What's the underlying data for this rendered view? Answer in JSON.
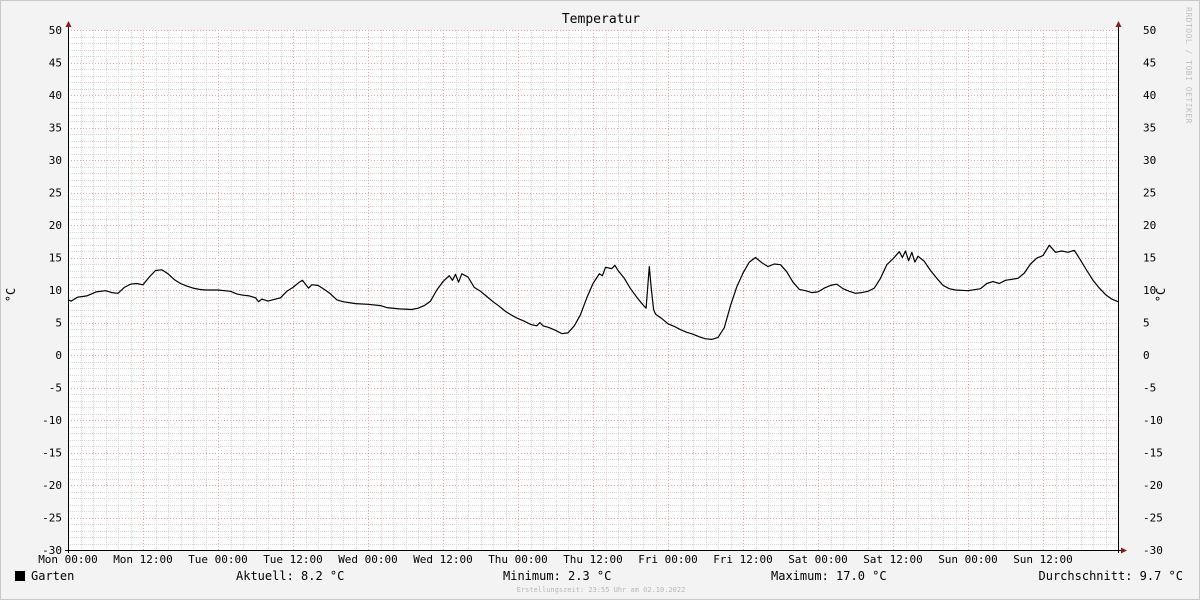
{
  "chart_data": {
    "type": "line",
    "title": "Temperatur",
    "ylabel_left": "°C",
    "ylabel_right": "°C",
    "ylim": [
      -30,
      50
    ],
    "yticks": [
      50,
      45,
      40,
      35,
      30,
      25,
      20,
      15,
      10,
      5,
      0,
      -5,
      -10,
      -15,
      -20,
      -25,
      -30
    ],
    "xlim": [
      0,
      168
    ],
    "xticks": [
      {
        "x": 0,
        "label": "Mon 00:00"
      },
      {
        "x": 12,
        "label": "Mon 12:00"
      },
      {
        "x": 24,
        "label": "Tue 00:00"
      },
      {
        "x": 36,
        "label": "Tue 12:00"
      },
      {
        "x": 48,
        "label": "Wed 00:00"
      },
      {
        "x": 60,
        "label": "Wed 12:00"
      },
      {
        "x": 72,
        "label": "Thu 00:00"
      },
      {
        "x": 84,
        "label": "Thu 12:00"
      },
      {
        "x": 96,
        "label": "Fri 00:00"
      },
      {
        "x": 108,
        "label": "Fri 12:00"
      },
      {
        "x": 120,
        "label": "Sat 00:00"
      },
      {
        "x": 132,
        "label": "Sat 12:00"
      },
      {
        "x": 144,
        "label": "Sun 00:00"
      },
      {
        "x": 156,
        "label": "Sun 12:00"
      }
    ],
    "grid": true,
    "series": [
      {
        "name": "Garten",
        "color": "#000000",
        "points": [
          [
            0,
            8.5
          ],
          [
            0.5,
            8.3
          ],
          [
            1.5,
            8.9
          ],
          [
            3,
            9.1
          ],
          [
            4.5,
            9.7
          ],
          [
            6,
            9.9
          ],
          [
            7,
            9.6
          ],
          [
            8,
            9.5
          ],
          [
            9,
            10.4
          ],
          [
            10,
            10.9
          ],
          [
            11,
            11.0
          ],
          [
            12,
            10.8
          ],
          [
            13,
            12.0
          ],
          [
            14,
            13.0
          ],
          [
            15,
            13.1
          ],
          [
            16,
            12.5
          ],
          [
            17,
            11.6
          ],
          [
            18,
            11.0
          ],
          [
            19,
            10.6
          ],
          [
            20,
            10.3
          ],
          [
            21,
            10.1
          ],
          [
            22,
            10.0
          ],
          [
            24,
            10.0
          ],
          [
            26,
            9.8
          ],
          [
            27,
            9.4
          ],
          [
            28,
            9.2
          ],
          [
            29,
            9.1
          ],
          [
            30,
            8.8
          ],
          [
            30.5,
            8.2
          ],
          [
            31,
            8.6
          ],
          [
            32,
            8.3
          ],
          [
            34,
            8.8
          ],
          [
            35,
            9.8
          ],
          [
            36,
            10.4
          ],
          [
            37,
            11.2
          ],
          [
            37.5,
            11.5
          ],
          [
            38,
            10.9
          ],
          [
            38.5,
            10.3
          ],
          [
            39,
            10.8
          ],
          [
            40,
            10.7
          ],
          [
            41,
            10.1
          ],
          [
            42,
            9.4
          ],
          [
            43,
            8.5
          ],
          [
            44,
            8.2
          ],
          [
            46,
            7.9
          ],
          [
            48,
            7.8
          ],
          [
            50,
            7.6
          ],
          [
            51,
            7.3
          ],
          [
            53,
            7.1
          ],
          [
            55,
            7.0
          ],
          [
            56,
            7.2
          ],
          [
            57,
            7.6
          ],
          [
            58,
            8.3
          ],
          [
            59,
            10.0
          ],
          [
            60,
            11.3
          ],
          [
            61,
            12.2
          ],
          [
            61.5,
            11.5
          ],
          [
            62,
            12.4
          ],
          [
            62.5,
            11.2
          ],
          [
            63,
            12.5
          ],
          [
            64,
            12.0
          ],
          [
            65,
            10.4
          ],
          [
            66,
            9.8
          ],
          [
            67,
            9.0
          ],
          [
            68,
            8.2
          ],
          [
            69,
            7.5
          ],
          [
            70,
            6.7
          ],
          [
            71,
            6.1
          ],
          [
            72,
            5.6
          ],
          [
            73,
            5.2
          ],
          [
            74,
            4.7
          ],
          [
            75,
            4.5
          ],
          [
            75.5,
            5.0
          ],
          [
            76,
            4.5
          ],
          [
            77,
            4.2
          ],
          [
            78,
            3.8
          ],
          [
            79,
            3.3
          ],
          [
            80,
            3.4
          ],
          [
            81,
            4.5
          ],
          [
            82,
            6.2
          ],
          [
            83,
            8.8
          ],
          [
            84,
            11.0
          ],
          [
            85,
            12.5
          ],
          [
            85.5,
            12.2
          ],
          [
            86,
            13.5
          ],
          [
            87,
            13.3
          ],
          [
            87.5,
            13.8
          ],
          [
            88,
            13.0
          ],
          [
            89,
            11.8
          ],
          [
            90,
            10.2
          ],
          [
            91,
            8.9
          ],
          [
            92,
            7.7
          ],
          [
            92.5,
            7.2
          ],
          [
            93,
            13.6
          ],
          [
            93.3,
            10.5
          ],
          [
            93.7,
            7.0
          ],
          [
            94,
            6.3
          ],
          [
            95,
            5.6
          ],
          [
            96,
            4.8
          ],
          [
            97,
            4.4
          ],
          [
            98,
            3.9
          ],
          [
            99,
            3.5
          ],
          [
            100,
            3.2
          ],
          [
            101,
            2.8
          ],
          [
            102,
            2.5
          ],
          [
            103,
            2.4
          ],
          [
            104,
            2.7
          ],
          [
            105,
            4.2
          ],
          [
            106,
            7.6
          ],
          [
            107,
            10.5
          ],
          [
            108,
            12.6
          ],
          [
            109,
            14.3
          ],
          [
            110,
            15.0
          ],
          [
            111,
            14.2
          ],
          [
            112,
            13.6
          ],
          [
            113,
            14.0
          ],
          [
            114,
            13.9
          ],
          [
            115,
            12.8
          ],
          [
            116,
            11.2
          ],
          [
            117,
            10.1
          ],
          [
            118,
            9.9
          ],
          [
            119,
            9.6
          ],
          [
            120,
            9.7
          ],
          [
            121,
            10.3
          ],
          [
            122,
            10.7
          ],
          [
            123,
            10.9
          ],
          [
            124,
            10.2
          ],
          [
            125,
            9.8
          ],
          [
            126,
            9.5
          ],
          [
            127,
            9.6
          ],
          [
            128,
            9.8
          ],
          [
            129,
            10.3
          ],
          [
            130,
            11.8
          ],
          [
            131,
            13.9
          ],
          [
            132,
            14.8
          ],
          [
            133,
            15.9
          ],
          [
            133.5,
            15.0
          ],
          [
            134,
            16.0
          ],
          [
            134.5,
            14.5
          ],
          [
            135,
            15.8
          ],
          [
            135.5,
            14.3
          ],
          [
            136,
            15.2
          ],
          [
            137,
            14.4
          ],
          [
            138,
            13.0
          ],
          [
            139,
            11.8
          ],
          [
            140,
            10.7
          ],
          [
            141,
            10.2
          ],
          [
            142,
            10.0
          ],
          [
            144,
            9.9
          ],
          [
            146,
            10.2
          ],
          [
            147,
            11.0
          ],
          [
            148,
            11.3
          ],
          [
            149,
            11.0
          ],
          [
            150,
            11.5
          ],
          [
            152,
            11.8
          ],
          [
            153,
            12.6
          ],
          [
            154,
            14.0
          ],
          [
            155,
            14.9
          ],
          [
            156,
            15.3
          ],
          [
            157,
            16.9
          ],
          [
            158,
            15.8
          ],
          [
            159,
            16.0
          ],
          [
            160,
            15.8
          ],
          [
            161,
            16.1
          ],
          [
            162,
            14.6
          ],
          [
            163,
            13.0
          ],
          [
            164,
            11.5
          ],
          [
            165,
            10.3
          ],
          [
            166,
            9.3
          ],
          [
            167,
            8.6
          ],
          [
            168,
            8.2
          ]
        ]
      }
    ],
    "legend": {
      "series_name": "Garten",
      "aktuell": "Aktuell: 8.2 °C",
      "minimum": "Minimum: 2.3 °C",
      "maximum": "Maximum: 17.0 °C",
      "durchschnitt": "Durchschnitt: 9.7 °C"
    },
    "watermark": "RRDTOOL / TOBI OETIKER",
    "footer": "Erstellungszeit: 23:55 Uhr am 02.10.2022"
  },
  "colors": {
    "background": "#f3f3f3",
    "plot_background": "#ffffff",
    "minor_grid": "#d6d6d6",
    "major_grid": "#f0a0a0",
    "arrow": "#8b1a1a",
    "line": "#000000"
  }
}
